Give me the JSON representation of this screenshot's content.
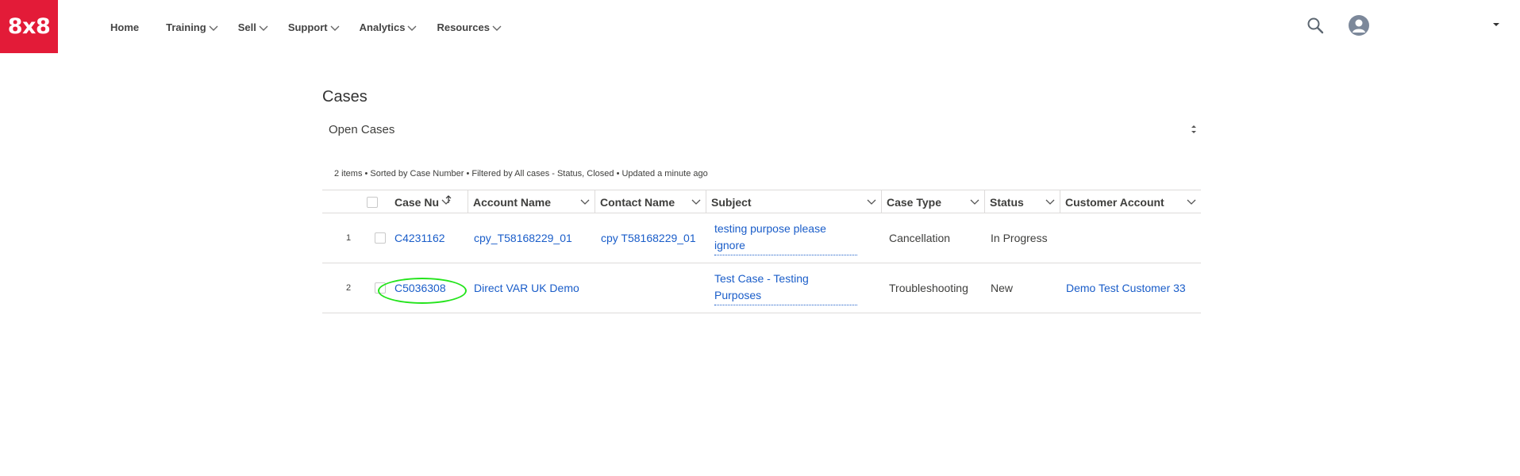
{
  "header": {
    "logo_text": "8x8",
    "nav": [
      {
        "label": "Home",
        "has_dropdown": false
      },
      {
        "label": "Training",
        "has_dropdown": true
      },
      {
        "label": "Sell",
        "has_dropdown": true
      },
      {
        "label": "Support",
        "has_dropdown": true
      },
      {
        "label": "Analytics",
        "has_dropdown": true
      },
      {
        "label": "Resources",
        "has_dropdown": true
      }
    ],
    "icons": {
      "search": "search-icon",
      "avatar": "user-avatar-icon",
      "menu": "caret-down-icon"
    }
  },
  "main": {
    "title": "Cases",
    "list_view_name": "Open Cases",
    "summary": "2 items • Sorted by Case Number • Filtered by All cases - Status, Closed • Updated a minute ago",
    "columns": [
      "Case Nu",
      "Account Name",
      "Contact Name",
      "Subject",
      "Case Type",
      "Status",
      "Customer Account"
    ],
    "rows": [
      {
        "num": "1",
        "case_number": "C4231162",
        "account_name": "cpy_T58168229_01",
        "contact_name": "cpy T58168229_01",
        "subject": "testing purpose please ignore",
        "case_type": "Cancellation",
        "status": "In Progress",
        "customer_account": ""
      },
      {
        "num": "2",
        "case_number": "C5036308",
        "account_name": "Direct VAR UK Demo",
        "contact_name": "",
        "subject": "Test Case - Testing Purposes",
        "case_type": "Troubleshooting",
        "status": "New",
        "customer_account": "Demo Test Customer 33"
      }
    ]
  },
  "colors": {
    "brand": "#e31b38",
    "link": "#1a5dc9",
    "highlight": "#24e41c",
    "border": "#dddbda"
  }
}
